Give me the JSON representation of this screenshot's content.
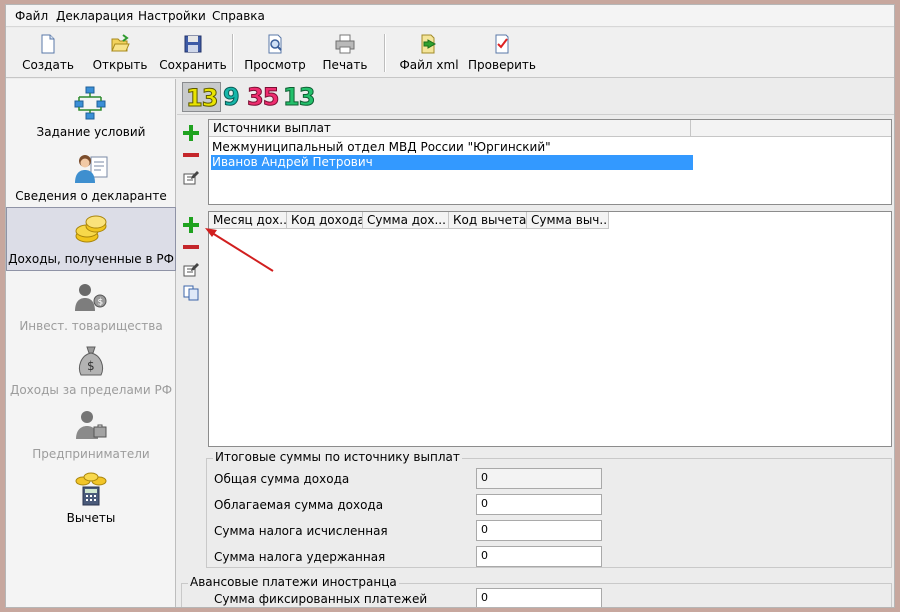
{
  "menu": [
    "Файл",
    "Декларация",
    "Настройки",
    "Справка"
  ],
  "toolbar": {
    "create": "Создать",
    "open": "Открыть",
    "save": "Сохранить",
    "preview": "Просмотр",
    "print": "Печать",
    "xml": "Файл xml",
    "check": "Проверить"
  },
  "sidebar": [
    {
      "label": "Задание условий",
      "state": "normal"
    },
    {
      "label": "Сведения о декларанте",
      "state": "normal"
    },
    {
      "label": "Доходы, полученные в РФ",
      "state": "active"
    },
    {
      "label": "Инвест. товарищества",
      "state": "disabled"
    },
    {
      "label": "Доходы за пределами РФ",
      "state": "disabled"
    },
    {
      "label": "Предприниматели",
      "state": "disabled"
    },
    {
      "label": "Вычеты",
      "state": "normal"
    }
  ],
  "rate_tabs": [
    {
      "label": "13",
      "color": "#e9e400",
      "selected": true
    },
    {
      "label": "9",
      "color": "#16b6a9",
      "selected": false
    },
    {
      "label": "35",
      "color": "#ee2d6f",
      "selected": false
    },
    {
      "label": "13",
      "color": "#23c06b",
      "selected": false
    }
  ],
  "sources": {
    "header": "Источники выплат",
    "rows": [
      "Межмуниципальный отдел МВД России \"Юргинский\"",
      "Иванов Андрей Петрович"
    ],
    "selected_index": 1
  },
  "income_grid": {
    "columns": [
      "Месяц дох...",
      "Код дохода",
      "Сумма дох...",
      "Код вычета",
      "Сумма выч..."
    ]
  },
  "totals": {
    "title": "Итоговые суммы по источнику выплат",
    "fields": [
      {
        "label": "Общая сумма дохода",
        "value": "0"
      },
      {
        "label": "Облагаемая сумма дохода",
        "value": "0"
      },
      {
        "label": "Сумма налога исчисленная",
        "value": "0"
      },
      {
        "label": "Сумма налога удержанная",
        "value": "0"
      }
    ]
  },
  "advance": {
    "title": "Авансовые платежи иностранца",
    "label": "Сумма фиксированных платежей",
    "value": "0"
  },
  "colors": {
    "selection": "#3399ff",
    "add_green": "#1fa21f",
    "remove_red": "#c4262b",
    "arrow_red": "#d11f1f"
  }
}
